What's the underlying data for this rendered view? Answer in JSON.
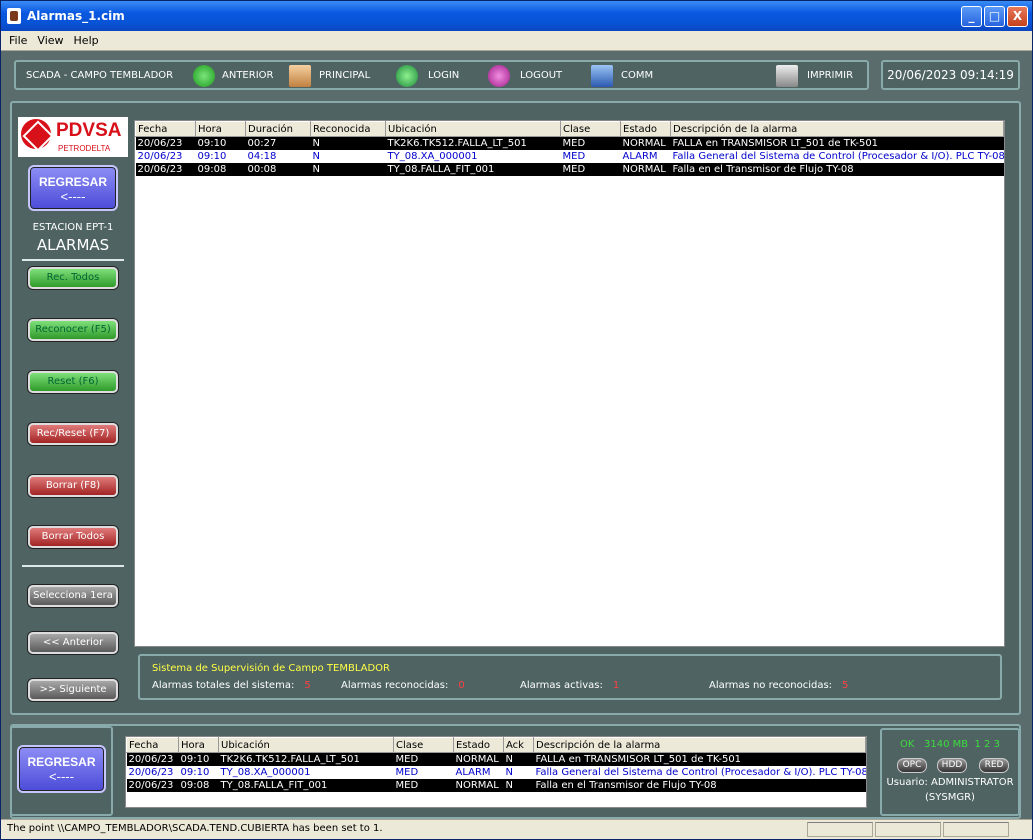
{
  "window": {
    "title": "Alarmas_1.cim",
    "minimize": "_",
    "maximize": "□",
    "close": "X"
  },
  "menu": [
    "File",
    "View",
    "Help"
  ],
  "toolbar": {
    "app": "SCADA - CAMPO TEMBLADOR",
    "anterior": "ANTERIOR",
    "principal": "PRINCIPAL",
    "login": "LOGIN",
    "logout": "LOGOUT",
    "comm": "COMM",
    "imprimir": "IMPRIMIR"
  },
  "clock": "20/06/2023 09:14:19",
  "logo": {
    "brand": "PDVSA",
    "sub": "PETRODELTA"
  },
  "sidebar": {
    "regresar": "REGRESAR",
    "arrow": "<----",
    "station": "ESTACION EPT-1",
    "title": "ALARMAS",
    "buttons": {
      "rec_todos": "Rec. Todos",
      "reconocer": "Reconocer (F5)",
      "reset": "Reset (F6)",
      "rec_reset": "Rec/Reset (F7)",
      "borrar": "Borrar (F8)",
      "borrar_todos": "Borrar Todos",
      "selecciona": "Selecciona 1era",
      "anterior": "<< Anterior",
      "siguiente": ">> Siguiente"
    }
  },
  "alarm_table": {
    "headers": [
      "Fecha",
      "Hora",
      "Duración",
      "Reconocida",
      "Ubicación",
      "Clase",
      "Estado",
      "Descripción de la alarma"
    ],
    "rows": [
      [
        "20/06/23",
        "09:10",
        "00:27",
        "N",
        "TK2K6.TK512.FALLA_LT_501",
        "MED",
        "NORMAL",
        "FALLA en TRANSMISOR LT_501 de TK-501"
      ],
      [
        "20/06/23",
        "09:10",
        "04:18",
        "N",
        "TY_08.XA_000001",
        "MED",
        "ALARM",
        "Falla General del Sistema de Control (Procesador & I/O). PLC TY-08"
      ],
      [
        "20/06/23",
        "09:08",
        "00:08",
        "N",
        "TY_08.FALLA_FIT_001",
        "MED",
        "NORMAL",
        "Falla en el Transmisor de Flujo TY-08"
      ]
    ]
  },
  "summary": {
    "title": "Sistema de Supervisión de Campo TEMBLADOR",
    "total_label": "Alarmas totales del sistema:",
    "total": "5",
    "ack_label": "Alarmas reconocidas:",
    "ack": "0",
    "active_label": "Alarmas activas:",
    "active": "1",
    "unack_label": "Alarmas no reconocidas:",
    "unack": "5"
  },
  "bottom": {
    "regresar": "REGRESAR",
    "arrow": "<----",
    "headers": [
      "Fecha",
      "Hora",
      "Ubicación",
      "Clase",
      "Estado",
      "Ack",
      "Descripción de la alarma"
    ],
    "rows": [
      [
        "20/06/23",
        "09:10",
        "TK2K6.TK512.FALLA_LT_501",
        "MED",
        "NORMAL",
        "N",
        "FALLA en TRANSMISOR LT_501 de TK-501"
      ],
      [
        "20/06/23",
        "09:10",
        "TY_08.XA_000001",
        "MED",
        "ALARM",
        "N",
        "Falla General del Sistema de Control (Procesador & I/O). PLC TY-08"
      ],
      [
        "20/06/23",
        "09:08",
        "TY_08.FALLA_FIT_001",
        "MED",
        "NORMAL",
        "N",
        "Falla en el Transmisor de Flujo TY-08"
      ]
    ]
  },
  "system": {
    "ok": "OK",
    "mem": "3140 MB",
    "nums": "1 2 3",
    "opc": "OPC",
    "hdd": "HDD",
    "red": "RED",
    "user": "Usuario: ADMINISTRATOR",
    "role": "(SYSMGR)"
  },
  "status": "The point \\\\CAMPO_TEMBLADOR\\SCADA.TEND.CUBIERTA has been set to 1.",
  "colors": {
    "panel": "#4f6363",
    "title_bar": "#0a58e0",
    "alarm_blue": "#0000cc"
  }
}
